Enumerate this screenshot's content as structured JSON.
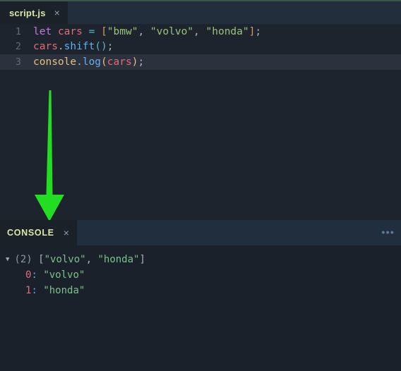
{
  "editor": {
    "tab": {
      "label": "script.js",
      "close_icon": "close-icon",
      "close_glyph": "×"
    },
    "lines": [
      {
        "number": "1",
        "active": false,
        "tokens": [
          {
            "text": "let",
            "type": "keyword"
          },
          {
            "text": " ",
            "type": "plain"
          },
          {
            "text": "cars",
            "type": "variable"
          },
          {
            "text": " ",
            "type": "plain"
          },
          {
            "text": "=",
            "type": "operator"
          },
          {
            "text": " ",
            "type": "plain"
          },
          {
            "text": "[",
            "type": "bracket"
          },
          {
            "text": "\"bmw\"",
            "type": "string"
          },
          {
            "text": ", ",
            "type": "punctuation"
          },
          {
            "text": "\"volvo\"",
            "type": "string"
          },
          {
            "text": ", ",
            "type": "punctuation"
          },
          {
            "text": "\"honda\"",
            "type": "string"
          },
          {
            "text": "]",
            "type": "bracket"
          },
          {
            "text": ";",
            "type": "punctuation"
          }
        ]
      },
      {
        "number": "2",
        "active": false,
        "tokens": [
          {
            "text": "cars",
            "type": "variable"
          },
          {
            "text": ".",
            "type": "punctuation"
          },
          {
            "text": "shift",
            "type": "function"
          },
          {
            "text": "()",
            "type": "operator"
          },
          {
            "text": ";",
            "type": "punctuation"
          }
        ]
      },
      {
        "number": "3",
        "active": true,
        "tokens": [
          {
            "text": "console",
            "type": "object"
          },
          {
            "text": ".",
            "type": "punctuation"
          },
          {
            "text": "log",
            "type": "function"
          },
          {
            "text": "(",
            "type": "paren"
          },
          {
            "text": "cars",
            "type": "variable"
          },
          {
            "text": ")",
            "type": "paren"
          },
          {
            "text": ";",
            "type": "punctuation"
          }
        ]
      }
    ]
  },
  "annotation": {
    "arrow_icon": "down-arrow-annotation",
    "color": "#23dd23"
  },
  "console": {
    "tab": {
      "label": "CONSOLE",
      "close_icon": "close-icon",
      "close_glyph": "×"
    },
    "menu_icon": "more-options-icon",
    "menu_glyph": "•••",
    "output": [
      {
        "kind": "array-root",
        "disclosure_glyph": "▼",
        "count": "(2)",
        "open_bracket": "[",
        "items": [
          "\"volvo\"",
          "\"honda\""
        ],
        "separator": ", ",
        "close_bracket": "]"
      },
      {
        "kind": "array-entry",
        "index": "0",
        "colon": ":",
        "value": "\"volvo\""
      },
      {
        "kind": "array-entry",
        "index": "1",
        "colon": ":",
        "value": "\"honda\""
      }
    ]
  },
  "colors": {
    "editor_bg": "#1e242e",
    "active_line_bg": "#2c323d",
    "tabbar_bg": "#222e3c",
    "console_header_bg": "#212e3d",
    "console_bg": "#1a212b",
    "tab_label": "#d9e7a8",
    "arrow_green": "#23dd23"
  }
}
